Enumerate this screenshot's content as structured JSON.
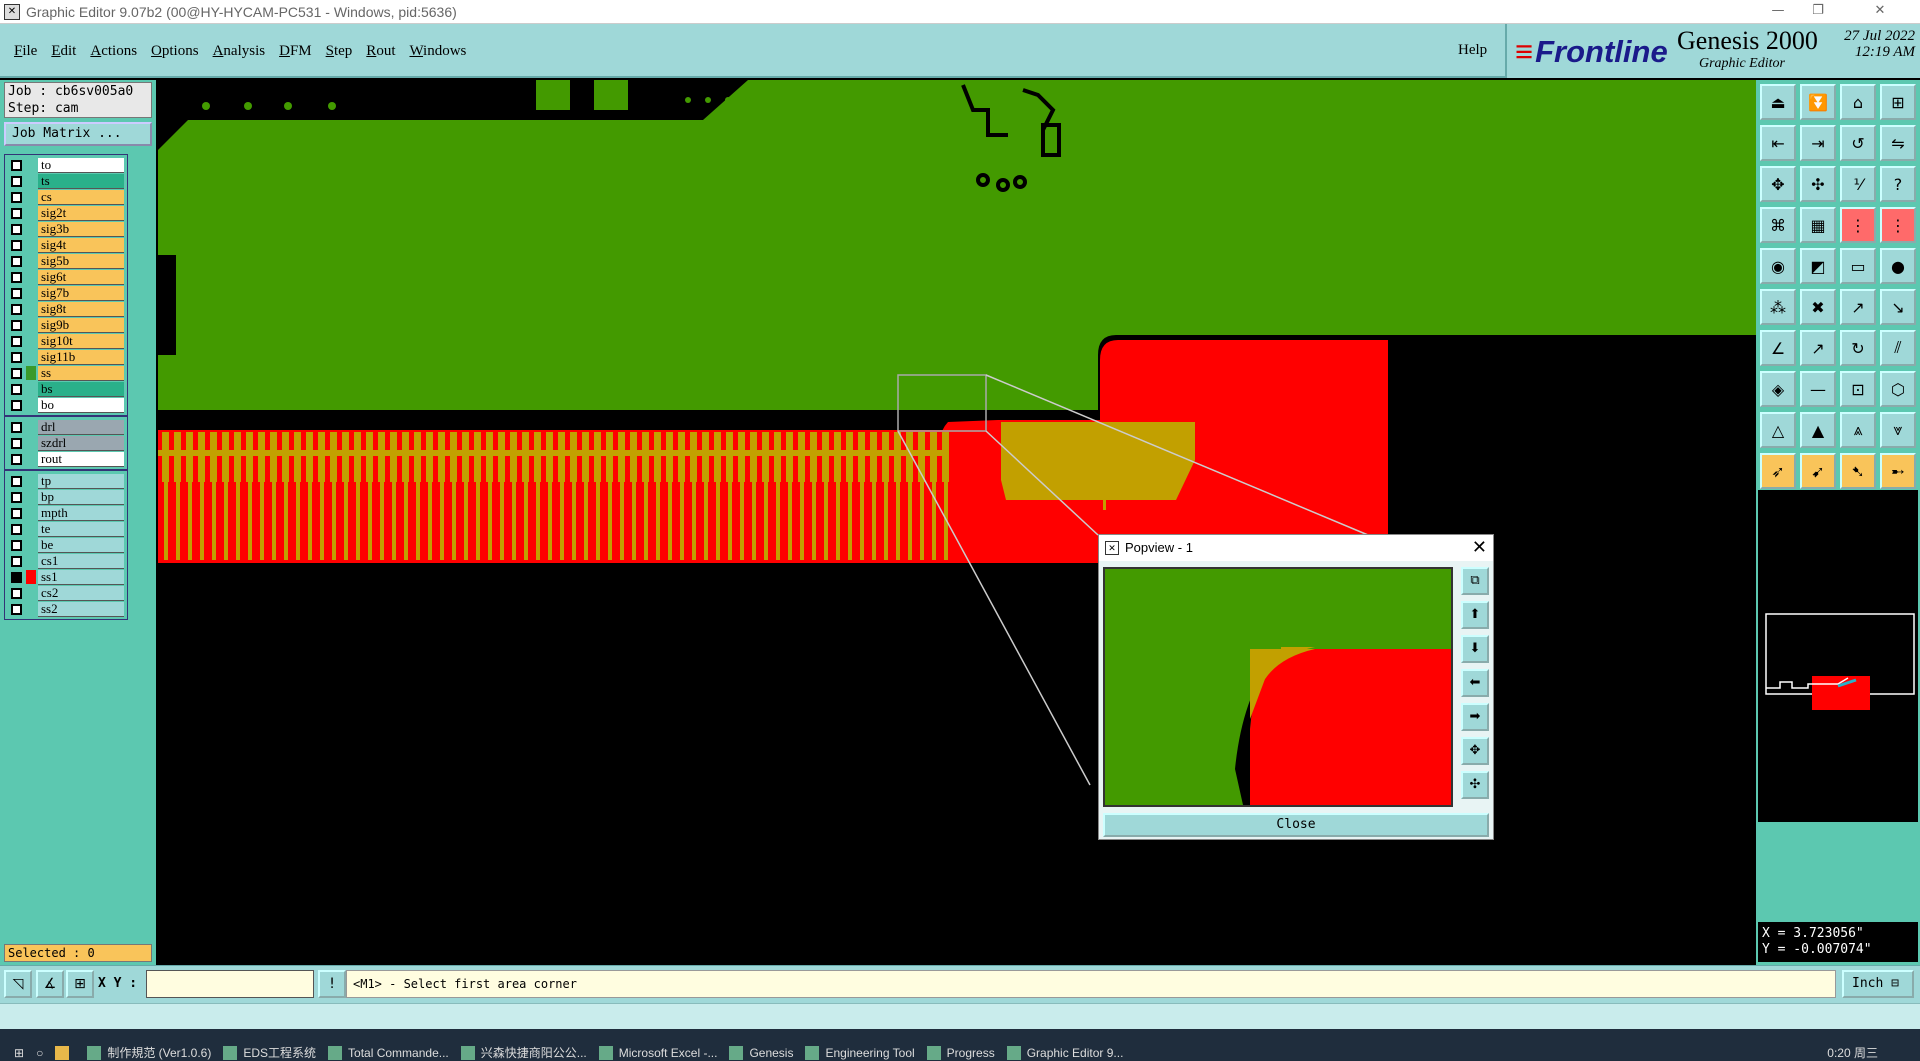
{
  "window": {
    "title": "Graphic Editor 9.07b2 (00@HY-HYCAM-PC531 - Windows, pid:5636)"
  },
  "menu": [
    "File",
    "Edit",
    "Actions",
    "Options",
    "Analysis",
    "DFM",
    "Step",
    "Rout",
    "Windows"
  ],
  "help_label": "Help",
  "brand": {
    "logo": "Frontline",
    "product": "Genesis 2000",
    "subtitle": "Graphic Editor",
    "date": "27 Jul 2022",
    "time": "12:19 AM"
  },
  "job": {
    "job_label": "Job : cb6sv005a0",
    "step_label": "Step: cam",
    "job_matrix": "Job Matrix ..."
  },
  "layers": {
    "group1": [
      {
        "name": "to",
        "color": "#ffffff"
      },
      {
        "name": "ts",
        "color": "#2ab08a"
      },
      {
        "name": "cs",
        "color": "#f9c45a"
      },
      {
        "name": "sig2t",
        "color": "#f9c45a"
      },
      {
        "name": "sig3b",
        "color": "#f9c45a"
      },
      {
        "name": "sig4t",
        "color": "#f9c45a"
      },
      {
        "name": "sig5b",
        "color": "#f9c45a"
      },
      {
        "name": "sig6t",
        "color": "#f9c45a"
      },
      {
        "name": "sig7b",
        "color": "#f9c45a"
      },
      {
        "name": "sig8t",
        "color": "#f9c45a"
      },
      {
        "name": "sig9b",
        "color": "#f9c45a"
      },
      {
        "name": "sig10t",
        "color": "#f9c45a"
      },
      {
        "name": "sig11b",
        "color": "#f9c45a"
      },
      {
        "name": "ss",
        "color": "#f9c45a"
      },
      {
        "name": "bs",
        "color": "#2ab08a"
      },
      {
        "name": "bo",
        "color": "#ffffff"
      }
    ],
    "group2": [
      {
        "name": "drl",
        "color": "#9aa7b0"
      },
      {
        "name": "szdrl",
        "color": "#9aa7b0"
      },
      {
        "name": "rout",
        "color": "#ffffff"
      }
    ],
    "group3": [
      {
        "name": "tp",
        "color": "#9fd8d8"
      },
      {
        "name": "bp",
        "color": "#9fd8d8"
      },
      {
        "name": "mpth",
        "color": "#9fd8d8"
      },
      {
        "name": "te",
        "color": "#9fd8d8"
      },
      {
        "name": "be",
        "color": "#9fd8d8"
      },
      {
        "name": "cs1",
        "color": "#9fd8d8"
      },
      {
        "name": "ss1",
        "color": "#9fd8d8"
      },
      {
        "name": "cs2",
        "color": "#9fd8d8"
      },
      {
        "name": "ss2",
        "color": "#9fd8d8"
      }
    ]
  },
  "selected_label": "Selected : 0",
  "coords": {
    "x": "X = 3.723056\"",
    "y": "Y = -0.007074\""
  },
  "status": {
    "xy_label": "X Y :",
    "xy_value": "",
    "prompt": "<M1> - Select first area corner",
    "units": "Inch ⊟"
  },
  "popview": {
    "title": "Popview - 1",
    "close": "Close"
  },
  "taskbar": [
    "制作規范 (Ver1.0.6)",
    "EDS工程系统",
    "Total Commande...",
    "兴森快捷商阳公公...",
    "Microsoft Excel -...",
    "Genesis",
    "Engineering Tool",
    "Progress",
    "Graphic Editor 9..."
  ],
  "clock": {
    "time": "0:20 周三"
  },
  "colors": {
    "board_green": "#439a00",
    "mask_red": "#ff0000",
    "pad_gold": "#c2a000",
    "panel_teal": "#5cc8b0",
    "menu_cyan": "#9fd8d8"
  }
}
